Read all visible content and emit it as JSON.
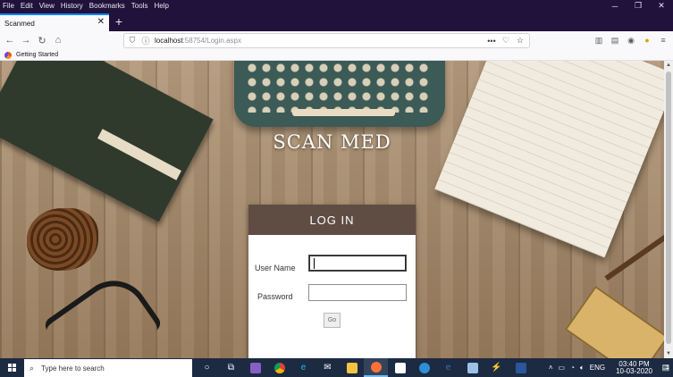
{
  "browser": {
    "menu": [
      "File",
      "Edit",
      "View",
      "History",
      "Bookmarks",
      "Tools",
      "Help"
    ],
    "tab_title": "Scanmed",
    "url_host": "localhost",
    "url_rest": ":58754/Login.aspx",
    "bookmark_label": "Getting Started",
    "icons": [
      "back-arrow",
      "forward-arrow",
      "reload",
      "home",
      "shield",
      "info",
      "more",
      "pocket",
      "star",
      "library",
      "sidebar",
      "account",
      "extension",
      "menu"
    ]
  },
  "page": {
    "brand": "SCAN MED",
    "login": {
      "heading": "LOG IN",
      "username_label": "User Name",
      "username_value": "",
      "password_label": "Password",
      "password_value": "",
      "go_label": "Go"
    },
    "colors": {
      "card_header": "#5f4d44",
      "card_body": "#ffffff"
    }
  },
  "taskbar": {
    "search_placeholder": "Type here to search",
    "pinned": [
      "cortana",
      "task-view",
      "visual-studio",
      "chrome",
      "internet-explorer",
      "mail",
      "file-explorer",
      "firefox",
      "store",
      "app",
      "edge",
      "app",
      "visual-studio-code",
      "word"
    ],
    "language": "ENG",
    "time": "03:40 PM",
    "date": "10-03-2020",
    "notification_count": "1"
  }
}
